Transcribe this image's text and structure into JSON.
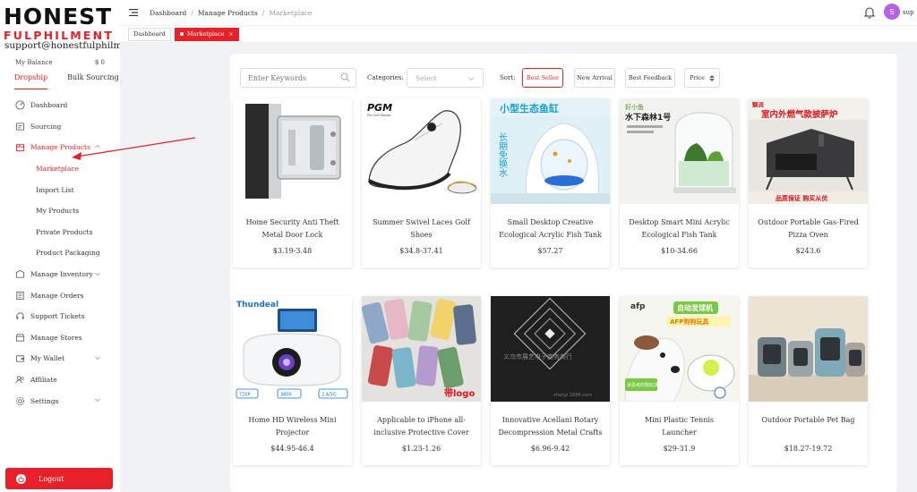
{
  "brand": {
    "name_top": "HONEST",
    "name_bottom": "FULPHILMENT"
  },
  "account": {
    "email": "support@honestfulphilment.com",
    "balance_label": "My Balance",
    "balance_value": "$ 0"
  },
  "modes": [
    "Dropship",
    "Bulk Sourcing"
  ],
  "menu": {
    "dashboard": "Dashboard",
    "sourcing": "Sourcing",
    "manage_products": "Manage Products",
    "sub": [
      "Marketplace",
      "Import List",
      "My Products",
      "Private Products",
      "Product Packaging"
    ],
    "manage_inventory": "Manage Inventory",
    "manage_orders": "Manage Orders",
    "support_tickets": "Support Tickets",
    "manage_stores": "Manage Stores",
    "my_wallet": "My Wallet",
    "affiliate": "Affiliate",
    "settings": "Settings"
  },
  "logout_label": "Logout",
  "header": {
    "breadcrumb": [
      "Dashboard",
      "Manage Products",
      "Marketplace"
    ],
    "avatar_letter": "S",
    "username": "sup"
  },
  "tabs": {
    "dashboard": "Dashboard",
    "marketplace": "Marketplace",
    "close": "×"
  },
  "filters": {
    "keyword_placeholder": "Enter Keywords",
    "categories_label": "Categories:",
    "categories_value": "Select",
    "sort_label": "Sort:",
    "sort_options": [
      "Best Seller",
      "New Arrival",
      "Best Feedback",
      "Price"
    ]
  },
  "products": [
    {
      "title": "Home Security Anti Theft Metal Door Lock",
      "price": "$3.19-3.48"
    },
    {
      "title": "Summer Swivel Laces Golf Shoes",
      "price": "$34.8-37.41",
      "brand_text": "PGM",
      "brand_sub": "Pro Golf Master"
    },
    {
      "title": "Small Desktop Creative Ecological Acrylic Fish Tank",
      "price": "$57.27",
      "banner_text": "小型生态鱼缸",
      "side_text": "长期免换水"
    },
    {
      "title": "Desktop Smart Mini Acrylic Ecological Fish Tank",
      "price": "$10-34.66",
      "brand_text": "好小鱼",
      "banner_text": "水下森林1号"
    },
    {
      "title": "Outdoor Portable Gas-Fired Pizza Oven",
      "price": "$243.6",
      "brand_text": "魅派",
      "banner_text": "室内外燃气款披萨炉",
      "footer_text": "品质保证 购买从优"
    },
    {
      "title": "Home HD Wireless Mini Projector",
      "price": "$44.95-46.4",
      "brand_text": "Thundeal",
      "badges": [
        "720P",
        "3800",
        "2.4/5G"
      ]
    },
    {
      "title": "Applicable to iPhone all-inclusive Protective Cover",
      "price": "$1.23-1.26",
      "logo_text": "带logo"
    },
    {
      "title": "Innovative Acellani Rotary Decompression Metal Crafts",
      "price": "$6.96-9.42",
      "watermark": "义乌市展艺电子商务商行",
      "small_text": "zhanyi.1688.com"
    },
    {
      "title": "Mini Plastic Tennis Launcher",
      "price": "$29-31.9",
      "brand_text": "afp",
      "banner_text": "自动发球机",
      "sub_text": "AFP狗狗玩具",
      "tag_text": "会思考的狗玩具"
    },
    {
      "title": "Outdoor Portable Pet Bag",
      "price": "$18.27-19.72"
    }
  ],
  "colors": {
    "accent": "#e8202a",
    "avatar": "#b462e6"
  }
}
